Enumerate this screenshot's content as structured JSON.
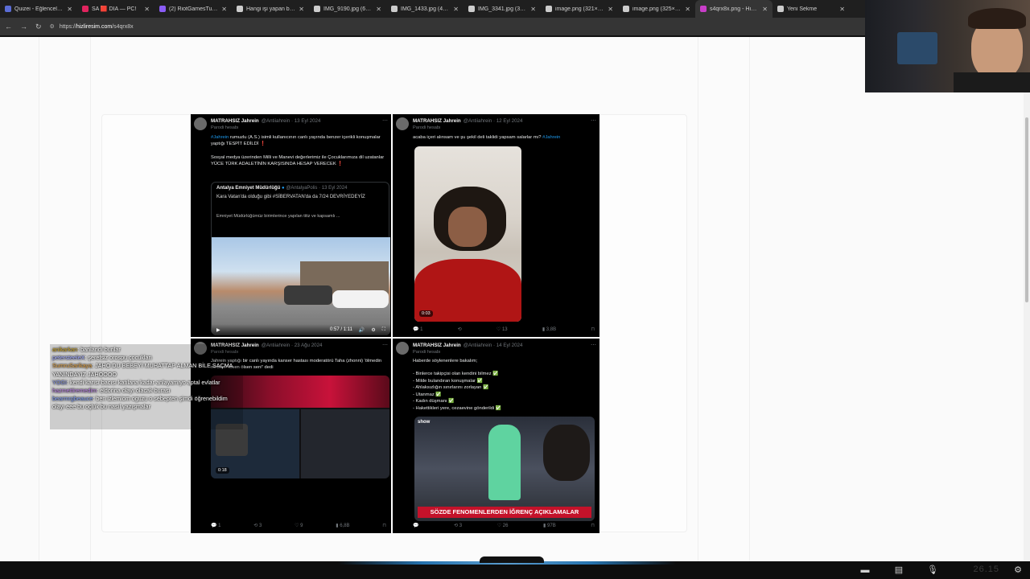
{
  "browser": {
    "tabs": [
      {
        "title": "Quizei - Eğlenceli ve ...",
        "favicon_color": "#5b6dd6",
        "active": false
      },
      {
        "title": "SA 🟥 DIA — PC!",
        "favicon_color": "#e0245e",
        "active": false
      },
      {
        "title": "(2) RiotGamesTurkish",
        "favicon_color": "#8a5cf6",
        "active": false
      },
      {
        "title": "Hangi işi yapan biri bir...",
        "favicon_color": "#cccccc",
        "active": false
      },
      {
        "title": "IMG_9190.jpg (6048×...",
        "favicon_color": "#cccccc",
        "active": false
      },
      {
        "title": "IMG_1433.jpg (4284×...",
        "favicon_color": "#cccccc",
        "active": false
      },
      {
        "title": "IMG_3341.jpg (3024×...",
        "favicon_color": "#cccccc",
        "active": false
      },
      {
        "title": "image.png (321×288)",
        "favicon_color": "#cccccc",
        "active": false
      },
      {
        "title": "image.png (325×281)",
        "favicon_color": "#cccccc",
        "active": false
      },
      {
        "title": "s4qrx8x.png - Hızlı Re...",
        "favicon_color": "#c93ec9",
        "active": true
      },
      {
        "title": "Yeni Sekme",
        "favicon_color": "#cccccc",
        "active": false
      }
    ],
    "url_prefix": "https://",
    "url_domain": "hizliresim.com",
    "url_path": "/s4qrx8x"
  },
  "tweets": [
    {
      "name": "MATRAHSIZ Jahrein",
      "handle": "@Antiiahrein · 13 Eyl 2024",
      "sub": "Parodi hesabı",
      "text_hl": "#Jahrein",
      "text1": "rumuzlu (A.S.) isimli kullanıcının canlı yayında benzer içerikli konuşmalar yaptığı TESPİT EDİLDİ ❗",
      "text2": "Sosyal medya üzerinden Milli ve Manevi değerlerimiz ile Çocuklarımıza dil uzatanlar YÜCE TÜRK ADALETİNİN KARŞISINDA HESAP VERECEK ❗",
      "quote_name": "Antalya Emniyet Müdürlüğü",
      "quote_handle": "@AntalyaPolis · 13 Eyl 2024",
      "quote_text": "Kara Vatan'da olduğu gibi #SİBERVATAN'da da 7/24 DEVRİYEDEYİZ",
      "quote_text2": "Emniyet Müdürlüğümüz birimlerince yapılan titiz ve kapsamlı ...",
      "video_time": "0:57 / 1:11"
    },
    {
      "name": "MATRAHSIZ Jahrein",
      "handle": "@Antiiahrein · 12 Eyl 2024",
      "sub": "Parodi hesabı",
      "text1": "acaba içeri alınsam ve şu şekil deli taklidi yapsam salarlar mı?",
      "text_hl": "#Jahrein",
      "video_time": "0:03",
      "stats": [
        "1",
        "",
        "13",
        "3,8B"
      ]
    },
    {
      "name": "MATRAHSIZ Jahrein",
      "handle": "@Antiiahrein · 23 Ağu 2024",
      "sub": "Parodi hesabı",
      "text1": "Jahrein yaptığı bir canlı yayında kanser hastası moderatörü Taha (zhonni) 'ölmedin mi sen? ölsen ölsen sen!' dedi",
      "video_time": "0:18",
      "stats": [
        "1",
        "3",
        "9",
        "6,8B"
      ]
    },
    {
      "name": "MATRAHSIZ Jahrein",
      "handle": "@Antiiahrein · 14 Eyl 2024",
      "sub": "Parodi hesabı",
      "text0": "Haberde söylenenlere bakalım;",
      "list": [
        "- Binlerce takipçisi olan kendini bilmez ✅",
        "- Milde bulandıran konuşmalar ✅",
        "- Ahlaksızlığın sınırlarını zorlayan ✅",
        "- Utanmaz ✅",
        "- Kadın düşmanı ✅",
        "- Hakettikleri yere, cezaevine gönderildi ✅"
      ],
      "news_banner": "SÖZDE FENOMENLERDEN İĞRENÇ AÇIKLAMALAR",
      "news_channel": "show",
      "stats": [
        "",
        "3",
        "26",
        "97B"
      ]
    }
  ],
  "chat": [
    {
      "user": "anikarkan",
      "msg": ": banlandı bunlar",
      "cls": "u1"
    },
    {
      "user": "petersteeleX",
      "msg": ": şerefsiz orospu çocukları",
      "cls": "u2"
    },
    {
      "user": "SumruSarikaya",
      "msg": ": JAHO DU BEBEYİ MUHATTAP ALMAN BİLE SAÇMA YANINDAYIZ JAHOOOO",
      "cls": "u3"
    },
    {
      "user": "YOGI",
      "msg": ": kendi karısı bacısı katılana kadar anlayamıyo aptal evlatlar",
      "cls": "u4"
    },
    {
      "user": "hazmettiremedim",
      "msg": ": eldorina olayı olacak burası",
      "cls": "u5"
    },
    {
      "user": "bearmrgbeauce",
      "msg": ": ben izlemiom oguzu o sebepten şimdi öğrenebildim olayı eee bu oçluk bu nasıl yazışmalar",
      "cls": "u6"
    }
  ],
  "taskbar": {
    "clock": "26.15"
  }
}
